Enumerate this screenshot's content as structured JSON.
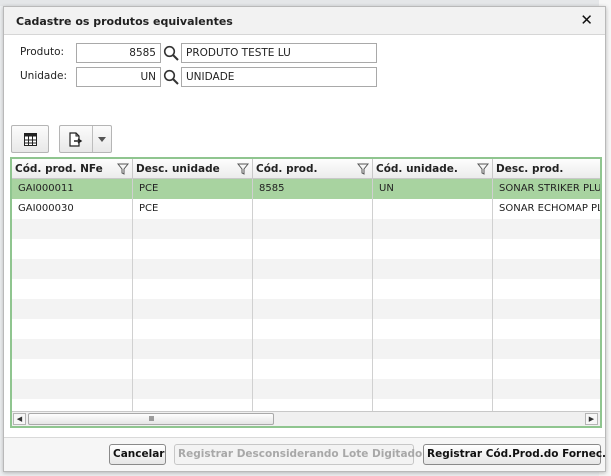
{
  "dialog": {
    "title": "Cadastre os produtos equivalentes",
    "close_symbol": "✕"
  },
  "form": {
    "produto": {
      "label": "Produto:",
      "code": "8585",
      "description": "PRODUTO TESTE LU"
    },
    "unidade": {
      "label": "Unidade:",
      "code": "UN",
      "description": "UNIDADE"
    }
  },
  "grid": {
    "columns": [
      {
        "label": "Cód. prod. NFe",
        "filter": true
      },
      {
        "label": "Desc. unidade",
        "filter": true
      },
      {
        "label": "Cód. prod.",
        "filter": true
      },
      {
        "label": "Cód. unidade.",
        "filter": true
      },
      {
        "label": "Desc. prod.",
        "filter": false
      }
    ],
    "rows": [
      {
        "cod_nfe": "GAI000011",
        "desc_unidade": "PCE",
        "cod_prod": "8585",
        "cod_unidade": "UN",
        "desc_prod": "SONAR STRIKER PLUS"
      },
      {
        "cod_nfe": "GAI000030",
        "desc_unidade": "PCE",
        "cod_prod": "",
        "cod_unidade": "",
        "desc_prod": "SONAR ECHOMAP PLUS"
      }
    ],
    "selected_row": 0,
    "scroll_left": "◀",
    "scroll_right": "▶",
    "thumb_grip": "IIIII"
  },
  "footer": {
    "cancel_label": "Cancelar",
    "register_ignore_label": "Registrar Desconsiderando Lote Digitado",
    "register_supplier_label": "Registrar Cód.Prod.do Fornec."
  },
  "colors": {
    "selected_row": "#a8d3a0",
    "grid_border": "#8fc58f"
  }
}
